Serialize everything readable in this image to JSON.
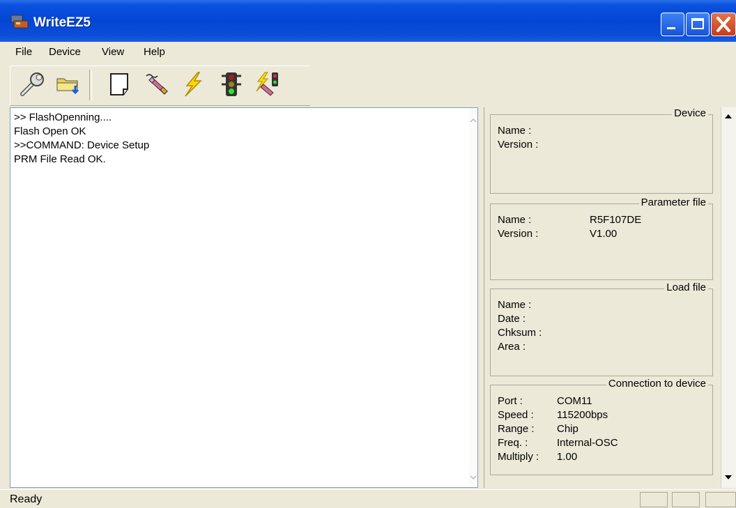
{
  "window": {
    "title": "WriteEZ5"
  },
  "menu": {
    "items": [
      "File",
      "Device",
      "View",
      "Help"
    ]
  },
  "toolbar": {
    "buttons": [
      "settings-wrench",
      "open-load-file",
      "new-file",
      "erase",
      "program-lightning",
      "traffic-light",
      "auto-program"
    ]
  },
  "log": {
    "lines": [
      ">> FlashOpenning....",
      "Flash Open OK",
      ">>COMMAND: Device Setup",
      "PRM File Read OK."
    ]
  },
  "device": {
    "title": "Device",
    "name_label": "Name :",
    "version_label": "Version :"
  },
  "parameter_file": {
    "title": "Parameter file",
    "name_label": "Name :",
    "name_value": "R5F107DE",
    "version_label": "Version :",
    "version_value": "V1.00"
  },
  "load_file": {
    "title": "Load file",
    "name_label": "Name :",
    "date_label": "Date :",
    "chksum_label": "Chksum :",
    "area_label": "Area :"
  },
  "connection": {
    "title": "Connection to device",
    "port_label": "Port :",
    "port_value": "COM11",
    "speed_label": "Speed :",
    "speed_value": "115200bps",
    "range_label": "Range :",
    "range_value": "Chip",
    "freq_label": "Freq. :",
    "freq_value": "Internal-OSC",
    "multiply_label": "Multiply :",
    "multiply_value": "1.00"
  },
  "status": {
    "text": "Ready"
  }
}
